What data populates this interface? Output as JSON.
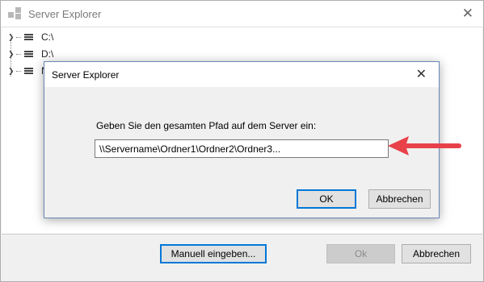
{
  "window": {
    "title": "Server Explorer",
    "close_glyph": "✕",
    "icon": "server-explorer-app-icon"
  },
  "tree": {
    "items": [
      {
        "label": "C:\\",
        "icon": "drive-icon"
      },
      {
        "label": "D:\\",
        "icon": "drive-icon"
      },
      {
        "label": "N",
        "icon": "drive-icon"
      }
    ],
    "expander_glyph": "❯"
  },
  "footer": {
    "manual_label": "Manuell eingeben...",
    "ok_label": "Ok",
    "cancel_label": "Abbrechen"
  },
  "dialog": {
    "title": "Server Explorer",
    "close_glyph": "✕",
    "prompt": "Geben Sie den gesamten Pfad auf dem Server ein:",
    "path_value": "\\\\Servername\\Ordner1\\Ordner2\\Ordner3...",
    "ok_label": "OK",
    "cancel_label": "Abbrechen"
  },
  "annotation": {
    "arrow_color": "#e8414a",
    "arrow_icon": "red-arrow-pointing-left"
  }
}
